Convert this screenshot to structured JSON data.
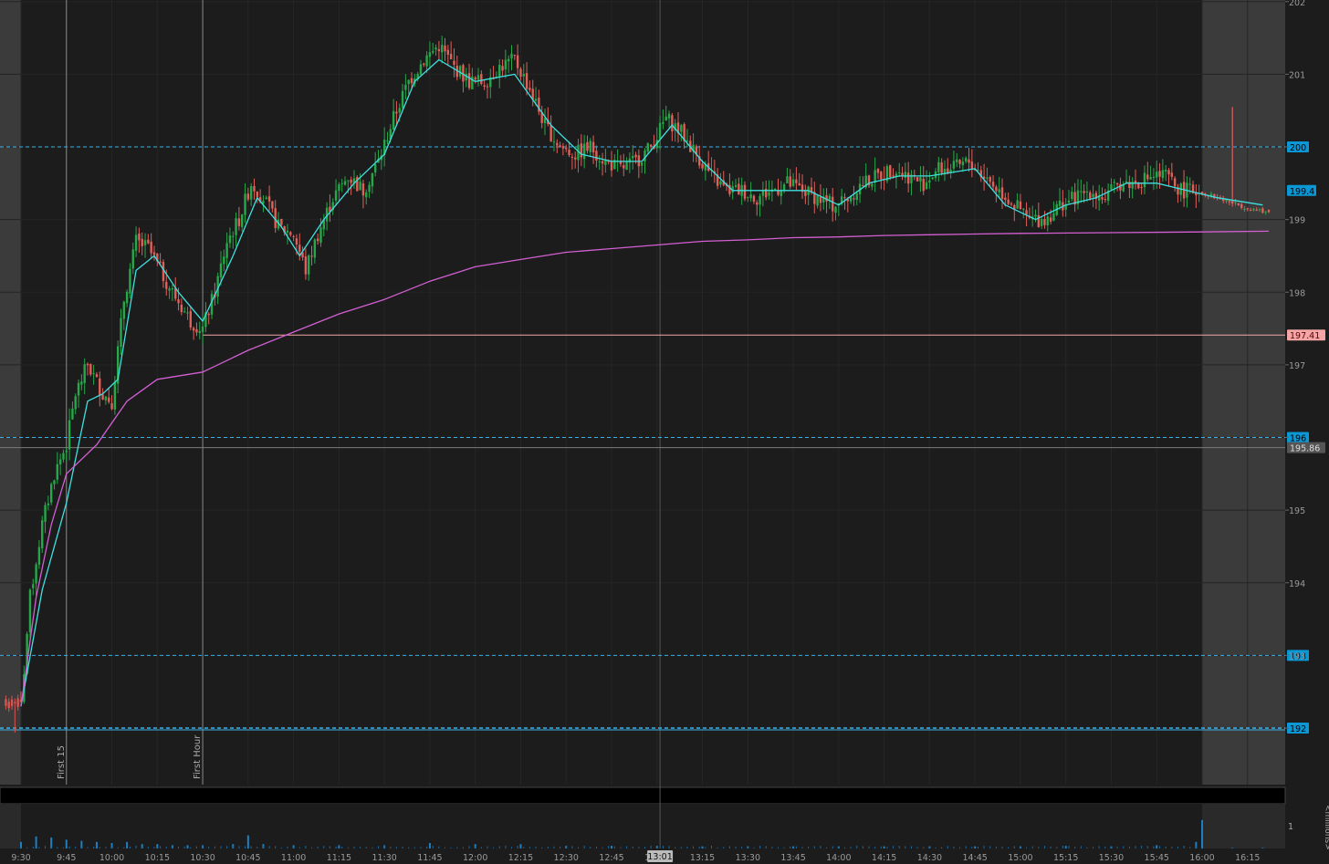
{
  "chart_data": {
    "type": "candlestick",
    "title": "",
    "ylim": [
      191.5,
      202
    ],
    "y_ticks": [
      192,
      193,
      194,
      195,
      196,
      197,
      198,
      199,
      200,
      201,
      202
    ],
    "x_ticks": [
      "9:30",
      "9:45",
      "10:00",
      "10:15",
      "10:30",
      "10:45",
      "11:00",
      "11:15",
      "11:30",
      "11:45",
      "12:00",
      "12:15",
      "12:30",
      "12:45",
      "13:00",
      "13:15",
      "13:30",
      "13:45",
      "14:00",
      "14:15",
      "14:30",
      "14:45",
      "15:00",
      "15:15",
      "15:30",
      "15:45",
      "16:00",
      "16:15"
    ],
    "x_end": "16:22",
    "sessions": {
      "premarket_end": "9:30",
      "afterhours_start": "16:00"
    },
    "cursor_time": "13:01",
    "markers": [
      {
        "time": "9:45",
        "label": "First 15"
      },
      {
        "time": "10:30",
        "label": "First Hour"
      }
    ],
    "horizontal_levels": [
      {
        "value": 200,
        "label": "200",
        "style": "dashed",
        "color": "#3ab0e8"
      },
      {
        "value": 196,
        "label": "196",
        "style": "dashed",
        "color": "#3ab0e8"
      },
      {
        "value": 193,
        "label": "193",
        "style": "dashed",
        "color": "#3ab0e8"
      },
      {
        "value": 192,
        "label": "192",
        "style": "dashed",
        "color": "#3ab0e8"
      },
      {
        "value": 197.41,
        "label": "197.41",
        "style": "solid",
        "color": "#f4a6a6"
      },
      {
        "value": 195.86,
        "label": "195.86",
        "style": "solid",
        "color": "#7a7a7a"
      }
    ],
    "last_price": {
      "value": 199.4,
      "label": "199.4"
    },
    "price_path": [
      [
        "9:30",
        192.3
      ],
      [
        "9:33",
        193.8
      ],
      [
        "9:37",
        194.8
      ],
      [
        "9:41",
        195.5
      ],
      [
        "9:45",
        195.9
      ],
      [
        "9:48",
        196.6
      ],
      [
        "9:52",
        197.0
      ],
      [
        "9:57",
        196.6
      ],
      [
        "10:00",
        196.5
      ],
      [
        "10:04",
        197.9
      ],
      [
        "10:08",
        198.7
      ],
      [
        "10:12",
        198.6
      ],
      [
        "10:16",
        198.3
      ],
      [
        "10:20",
        198.0
      ],
      [
        "10:26",
        197.6
      ],
      [
        "10:30",
        197.5
      ],
      [
        "10:34",
        198.0
      ],
      [
        "10:38",
        198.7
      ],
      [
        "10:42",
        199.0
      ],
      [
        "10:46",
        199.5
      ],
      [
        "10:50",
        199.3
      ],
      [
        "10:55",
        198.9
      ],
      [
        "11:00",
        198.8
      ],
      [
        "11:04",
        198.3
      ],
      [
        "11:08",
        198.8
      ],
      [
        "11:13",
        199.3
      ],
      [
        "11:18",
        199.6
      ],
      [
        "11:23",
        199.4
      ],
      [
        "11:28",
        199.8
      ],
      [
        "11:33",
        200.4
      ],
      [
        "11:38",
        200.9
      ],
      [
        "11:43",
        201.2
      ],
      [
        "11:48",
        201.4
      ],
      [
        "11:53",
        201.1
      ],
      [
        "11:58",
        200.9
      ],
      [
        "12:03",
        200.9
      ],
      [
        "12:08",
        201.1
      ],
      [
        "12:13",
        201.2
      ],
      [
        "12:18",
        200.8
      ],
      [
        "12:23",
        200.3
      ],
      [
        "12:28",
        200.0
      ],
      [
        "12:33",
        199.9
      ],
      [
        "12:38",
        200.0
      ],
      [
        "12:43",
        199.8
      ],
      [
        "12:48",
        199.7
      ],
      [
        "12:53",
        199.8
      ],
      [
        "12:58",
        200.0
      ],
      [
        "13:03",
        200.4
      ],
      [
        "13:08",
        200.2
      ],
      [
        "13:13",
        199.9
      ],
      [
        "13:18",
        199.6
      ],
      [
        "13:23",
        199.4
      ],
      [
        "13:28",
        199.4
      ],
      [
        "13:33",
        199.3
      ],
      [
        "13:38",
        199.4
      ],
      [
        "13:43",
        199.5
      ],
      [
        "13:48",
        199.4
      ],
      [
        "13:53",
        199.3
      ],
      [
        "13:58",
        199.2
      ],
      [
        "14:03",
        199.3
      ],
      [
        "14:08",
        199.5
      ],
      [
        "14:13",
        199.6
      ],
      [
        "14:18",
        199.7
      ],
      [
        "14:23",
        199.6
      ],
      [
        "14:28",
        199.5
      ],
      [
        "14:33",
        199.7
      ],
      [
        "14:38",
        199.7
      ],
      [
        "14:43",
        199.8
      ],
      [
        "14:48",
        199.6
      ],
      [
        "14:53",
        199.4
      ],
      [
        "14:58",
        199.2
      ],
      [
        "15:03",
        199.0
      ],
      [
        "15:08",
        199.0
      ],
      [
        "15:13",
        199.2
      ],
      [
        "15:18",
        199.3
      ],
      [
        "15:23",
        199.4
      ],
      [
        "15:28",
        199.3
      ],
      [
        "15:33",
        199.5
      ],
      [
        "15:38",
        199.5
      ],
      [
        "15:43",
        199.6
      ],
      [
        "15:48",
        199.6
      ],
      [
        "15:53",
        199.4
      ],
      [
        "15:58",
        199.4
      ],
      [
        "16:05",
        199.3
      ],
      [
        "16:12",
        199.2
      ],
      [
        "16:20",
        199.1
      ]
    ],
    "series": [
      {
        "name": "",
        "color": "#3fe0e0",
        "values": [
          [
            "9:30",
            192.3
          ],
          [
            "9:37",
            193.9
          ],
          [
            "9:45",
            195.1
          ],
          [
            "9:52",
            196.5
          ],
          [
            "9:57",
            196.6
          ],
          [
            "10:02",
            196.8
          ],
          [
            "10:08",
            198.3
          ],
          [
            "10:14",
            198.5
          ],
          [
            "10:22",
            198.0
          ],
          [
            "10:30",
            197.6
          ],
          [
            "10:40",
            198.5
          ],
          [
            "10:48",
            199.3
          ],
          [
            "10:56",
            198.9
          ],
          [
            "11:02",
            198.5
          ],
          [
            "11:10",
            199.0
          ],
          [
            "11:20",
            199.5
          ],
          [
            "11:30",
            199.9
          ],
          [
            "11:40",
            200.9
          ],
          [
            "11:48",
            201.2
          ],
          [
            "12:00",
            200.9
          ],
          [
            "12:13",
            201.0
          ],
          [
            "12:25",
            200.3
          ],
          [
            "12:35",
            199.9
          ],
          [
            "12:45",
            199.8
          ],
          [
            "12:55",
            199.8
          ],
          [
            "13:05",
            200.3
          ],
          [
            "13:15",
            199.8
          ],
          [
            "13:25",
            199.4
          ],
          [
            "13:35",
            199.4
          ],
          [
            "13:50",
            199.4
          ],
          [
            "14:00",
            199.2
          ],
          [
            "14:10",
            199.5
          ],
          [
            "14:20",
            199.6
          ],
          [
            "14:30",
            199.6
          ],
          [
            "14:45",
            199.7
          ],
          [
            "14:55",
            199.2
          ],
          [
            "15:05",
            199.0
          ],
          [
            "15:15",
            199.2
          ],
          [
            "15:25",
            199.3
          ],
          [
            "15:35",
            199.5
          ],
          [
            "15:45",
            199.5
          ],
          [
            "15:55",
            199.4
          ],
          [
            "16:05",
            199.3
          ],
          [
            "16:20",
            199.2
          ]
        ]
      },
      {
        "name": "",
        "color": "#d35fd3",
        "values": [
          [
            "9:30",
            192.3
          ],
          [
            "9:35",
            193.8
          ],
          [
            "9:40",
            194.8
          ],
          [
            "9:45",
            195.5
          ],
          [
            "9:55",
            195.9
          ],
          [
            "10:05",
            196.5
          ],
          [
            "10:15",
            196.8
          ],
          [
            "10:30",
            196.9
          ],
          [
            "10:45",
            197.2
          ],
          [
            "11:00",
            197.45
          ],
          [
            "11:15",
            197.7
          ],
          [
            "11:30",
            197.9
          ],
          [
            "11:45",
            198.15
          ],
          [
            "12:00",
            198.35
          ],
          [
            "12:15",
            198.45
          ],
          [
            "12:30",
            198.55
          ],
          [
            "12:45",
            198.6
          ],
          [
            "13:00",
            198.65
          ],
          [
            "13:15",
            198.7
          ],
          [
            "13:30",
            198.72
          ],
          [
            "13:45",
            198.75
          ],
          [
            "14:00",
            198.76
          ],
          [
            "14:15",
            198.78
          ],
          [
            "14:30",
            198.79
          ],
          [
            "14:45",
            198.8
          ],
          [
            "15:00",
            198.81
          ],
          [
            "15:30",
            198.82
          ],
          [
            "16:00",
            198.83
          ],
          [
            "16:22",
            198.84
          ]
        ]
      }
    ],
    "volume": {
      "axis_label": "<millions>",
      "y_ticks": [
        1
      ],
      "bars": [
        [
          "9:30",
          0.3
        ],
        [
          "9:35",
          0.55
        ],
        [
          "9:40",
          0.5
        ],
        [
          "9:45",
          0.4
        ],
        [
          "9:50",
          0.35
        ],
        [
          "9:55",
          0.3
        ],
        [
          "10:00",
          0.25
        ],
        [
          "10:05",
          0.3
        ],
        [
          "10:10",
          0.2
        ],
        [
          "10:15",
          0.2
        ],
        [
          "10:20",
          0.15
        ],
        [
          "10:25",
          0.15
        ],
        [
          "10:30",
          0.15
        ],
        [
          "10:40",
          0.2
        ],
        [
          "10:45",
          0.6
        ],
        [
          "10:50",
          0.2
        ],
        [
          "11:00",
          0.15
        ],
        [
          "11:15",
          0.15
        ],
        [
          "11:30",
          0.15
        ],
        [
          "11:45",
          0.25
        ],
        [
          "12:00",
          0.2
        ],
        [
          "12:15",
          0.2
        ],
        [
          "12:30",
          0.12
        ],
        [
          "12:45",
          0.12
        ],
        [
          "13:00",
          0.12
        ],
        [
          "13:15",
          0.1
        ],
        [
          "13:30",
          0.1
        ],
        [
          "13:45",
          0.1
        ],
        [
          "14:00",
          0.1
        ],
        [
          "14:15",
          0.1
        ],
        [
          "14:30",
          0.1
        ],
        [
          "14:45",
          0.1
        ],
        [
          "15:00",
          0.1
        ],
        [
          "15:15",
          0.12
        ],
        [
          "15:30",
          0.1
        ],
        [
          "15:45",
          0.15
        ],
        [
          "15:58",
          0.3
        ],
        [
          "16:00",
          1.3
        ],
        [
          "16:10",
          0.03
        ],
        [
          "16:20",
          0.03
        ]
      ]
    },
    "after_hours_spike": {
      "time": "16:10",
      "high": 200.55
    }
  }
}
